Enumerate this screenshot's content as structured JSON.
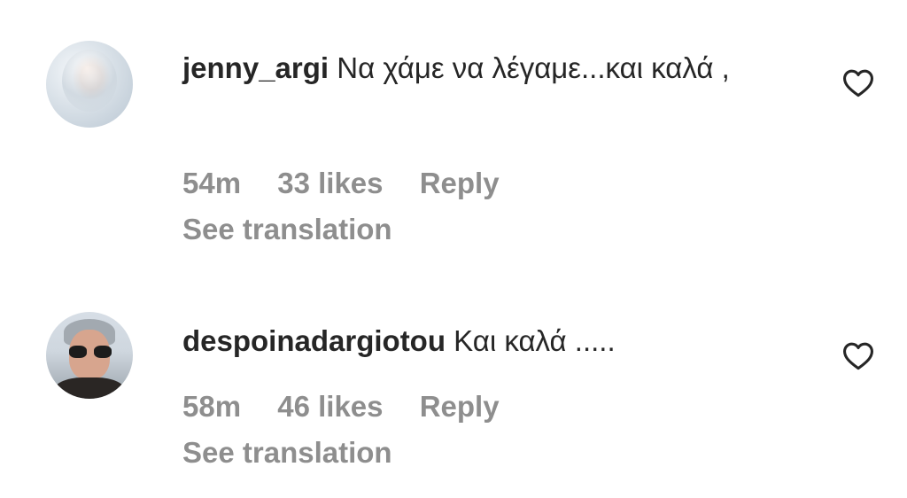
{
  "comments": [
    {
      "username": "jenny_argi",
      "text": "Να χάμε να λέγαμε...και καλά ,",
      "time": "54m",
      "likes": "33 likes",
      "reply_label": "Reply",
      "translation_label": "See translation",
      "like_icon": "heart-outline-icon"
    },
    {
      "username": "despoinadargiotou",
      "text": "Και καλά .....",
      "time": "58m",
      "likes": "46 likes",
      "reply_label": "Reply",
      "translation_label": "See translation",
      "like_icon": "heart-outline-icon"
    }
  ]
}
